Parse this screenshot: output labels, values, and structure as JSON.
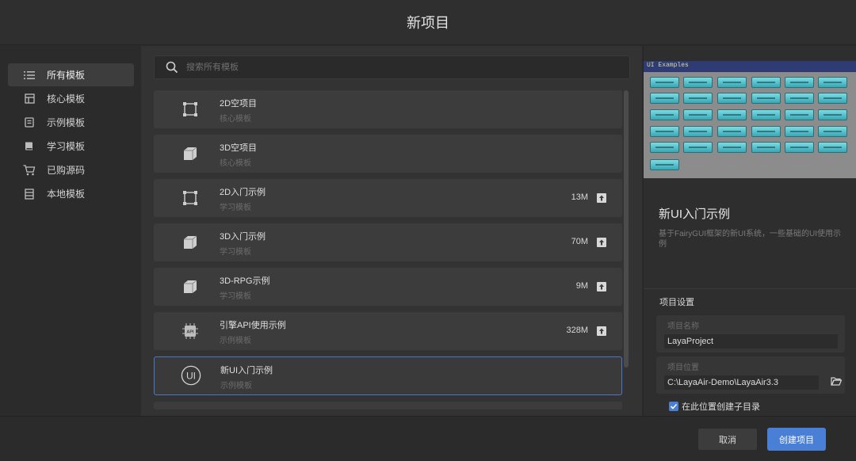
{
  "window": {
    "title": "新项目"
  },
  "sidebar": {
    "items": [
      {
        "label": "所有模板",
        "icon": "list-icon",
        "active": true
      },
      {
        "label": "核心模板",
        "icon": "core-template-icon",
        "active": false
      },
      {
        "label": "示例模板",
        "icon": "example-template-icon",
        "active": false
      },
      {
        "label": "学习模板",
        "icon": "book-icon",
        "active": false
      },
      {
        "label": "已购源码",
        "icon": "cart-icon",
        "active": false
      },
      {
        "label": "本地模板",
        "icon": "local-template-icon",
        "active": false
      }
    ]
  },
  "search": {
    "placeholder": "搜索所有模板"
  },
  "templates": [
    {
      "name": "2D空项目",
      "category": "核心模板",
      "size": "",
      "icon": "2d-square-icon"
    },
    {
      "name": "3D空项目",
      "category": "核心模板",
      "size": "",
      "icon": "3d-cube-icon"
    },
    {
      "name": "2D入门示例",
      "category": "学习模板",
      "size": "13M",
      "icon": "2d-square-icon"
    },
    {
      "name": "3D入门示例",
      "category": "学习模板",
      "size": "70M",
      "icon": "3d-cube-icon"
    },
    {
      "name": "3D-RPG示例",
      "category": "学习模板",
      "size": "9M",
      "icon": "3d-cube-icon"
    },
    {
      "name": "引擎API使用示例",
      "category": "示例模板",
      "size": "328M",
      "icon": "api-chip-icon"
    },
    {
      "name": "新UI入门示例",
      "category": "示例模板",
      "size": "",
      "icon": "ui-circle-icon"
    }
  ],
  "detail": {
    "preview_title": "UI Examples",
    "name": "新UI入门示例",
    "description": "基于FairyGUI框架的新UI系统，一些基础的UI使用示例",
    "settings_title": "项目设置",
    "project_name_label": "项目名称",
    "project_name": "LayaProject",
    "project_location_label": "项目位置",
    "project_location": "C:\\LayaAir-Demo\\LayaAir3.3",
    "create_subdir_label": "在此位置创建子目录",
    "create_subdir_checked": true
  },
  "footer": {
    "cancel_label": "取消",
    "create_label": "创建项目"
  },
  "colors": {
    "accent": "#4a7fd6",
    "preview_bg": "#8c8c8c",
    "preview_button": "#5cc6d0"
  }
}
